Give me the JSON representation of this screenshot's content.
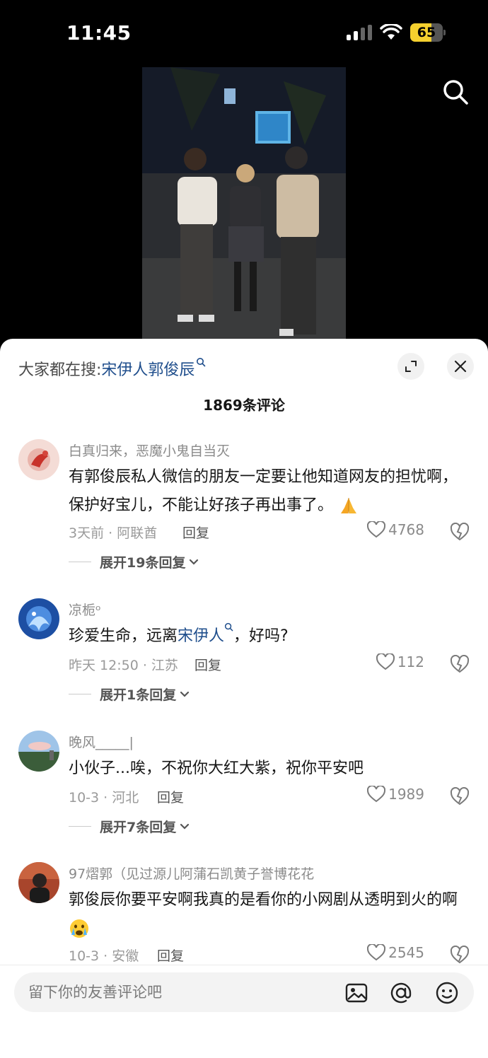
{
  "status_bar": {
    "time": "11:45",
    "battery": "65",
    "battery_level": 0.65
  },
  "video": {
    "search_icon": "search-icon"
  },
  "sheet": {
    "trending_prefix": "大家都在搜:",
    "trending_keyword": "宋伊人郭俊辰",
    "comment_count": "1869条评论"
  },
  "comments": [
    {
      "username": "白真归来，恶魔小鬼自当灭",
      "text": "有郭俊辰私人微信的朋友一定要让他知道网友的担忧啊，保护好宝儿，不能让好孩子再出事了。",
      "emoji": "folded-hands",
      "meta": "3天前 · 阿联酋",
      "reply": "回复",
      "likes": "4768",
      "expand": "展开19条回复"
    },
    {
      "username": "凉栀ᵒ",
      "text_before": "珍爱生命，远离",
      "text_keyword": "宋伊人",
      "text_after": "，好吗?",
      "meta": "昨天 12:50 · 江苏",
      "reply": "回复",
      "likes": "112",
      "expand": "展开1条回复"
    },
    {
      "username": "晚风_____|",
      "text": "小伙子...唉，不祝你大红大紫，祝你平安吧",
      "meta": "10-3 · 河北",
      "reply": "回复",
      "likes": "1989",
      "expand": "展开7条回复"
    },
    {
      "username": "97熠郭（见过源儿阿蒲石凯黄子誉博花花",
      "text": "郭俊辰你要平安啊我真的是看你的小网剧从透明到火的啊",
      "emoji": "crying-face",
      "meta": "10-3 · 安徽",
      "reply": "回复",
      "likes": "2545"
    }
  ],
  "input": {
    "placeholder": "留下你的友善评论吧"
  },
  "colors": {
    "keyword": "#1f4e8c",
    "battery": "#f5d02e",
    "text": "#161616",
    "muted": "#8a8a8a"
  }
}
